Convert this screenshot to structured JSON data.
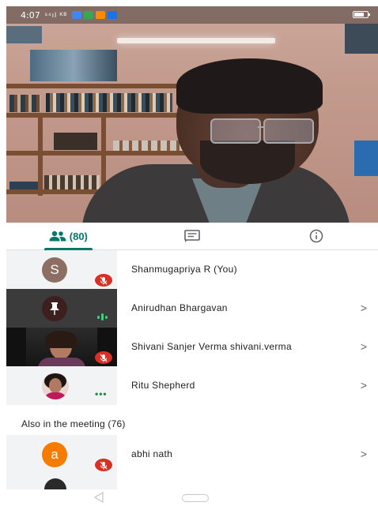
{
  "status_bar": {
    "time": "4:07",
    "signal": "ˢ⁴ıl ᴷᴮ"
  },
  "tabs": [
    {
      "id": "people",
      "icon": "people-icon",
      "count": "(80)",
      "active": true
    },
    {
      "id": "chat",
      "icon": "chat-icon",
      "active": false
    },
    {
      "id": "info",
      "icon": "info-icon",
      "active": false
    }
  ],
  "participants": [
    {
      "name": "Shanmugapriya R (You)",
      "avatar_letter": "S",
      "avatar_color": "#8d6e63",
      "status": "muted",
      "chevron": ""
    },
    {
      "name": "Anirudhan Bhargavan",
      "status": "speaking",
      "pinned": true,
      "chevron": ">"
    },
    {
      "name": "Shivani Sanjer Verma shivani.verma",
      "status": "muted",
      "chevron": ">"
    },
    {
      "name": "Ritu Shepherd",
      "status": "connecting",
      "chevron": ">"
    }
  ],
  "also_in_meeting": {
    "header": "Also in the meeting (76)",
    "participants": [
      {
        "name": "abhi nath",
        "avatar_letter": "a",
        "avatar_color": "#f57c00",
        "status": "muted",
        "chevron": ">"
      }
    ]
  },
  "colors": {
    "accent": "#00796b",
    "muted": "#d93025",
    "speaking": "#3ccf7e"
  }
}
